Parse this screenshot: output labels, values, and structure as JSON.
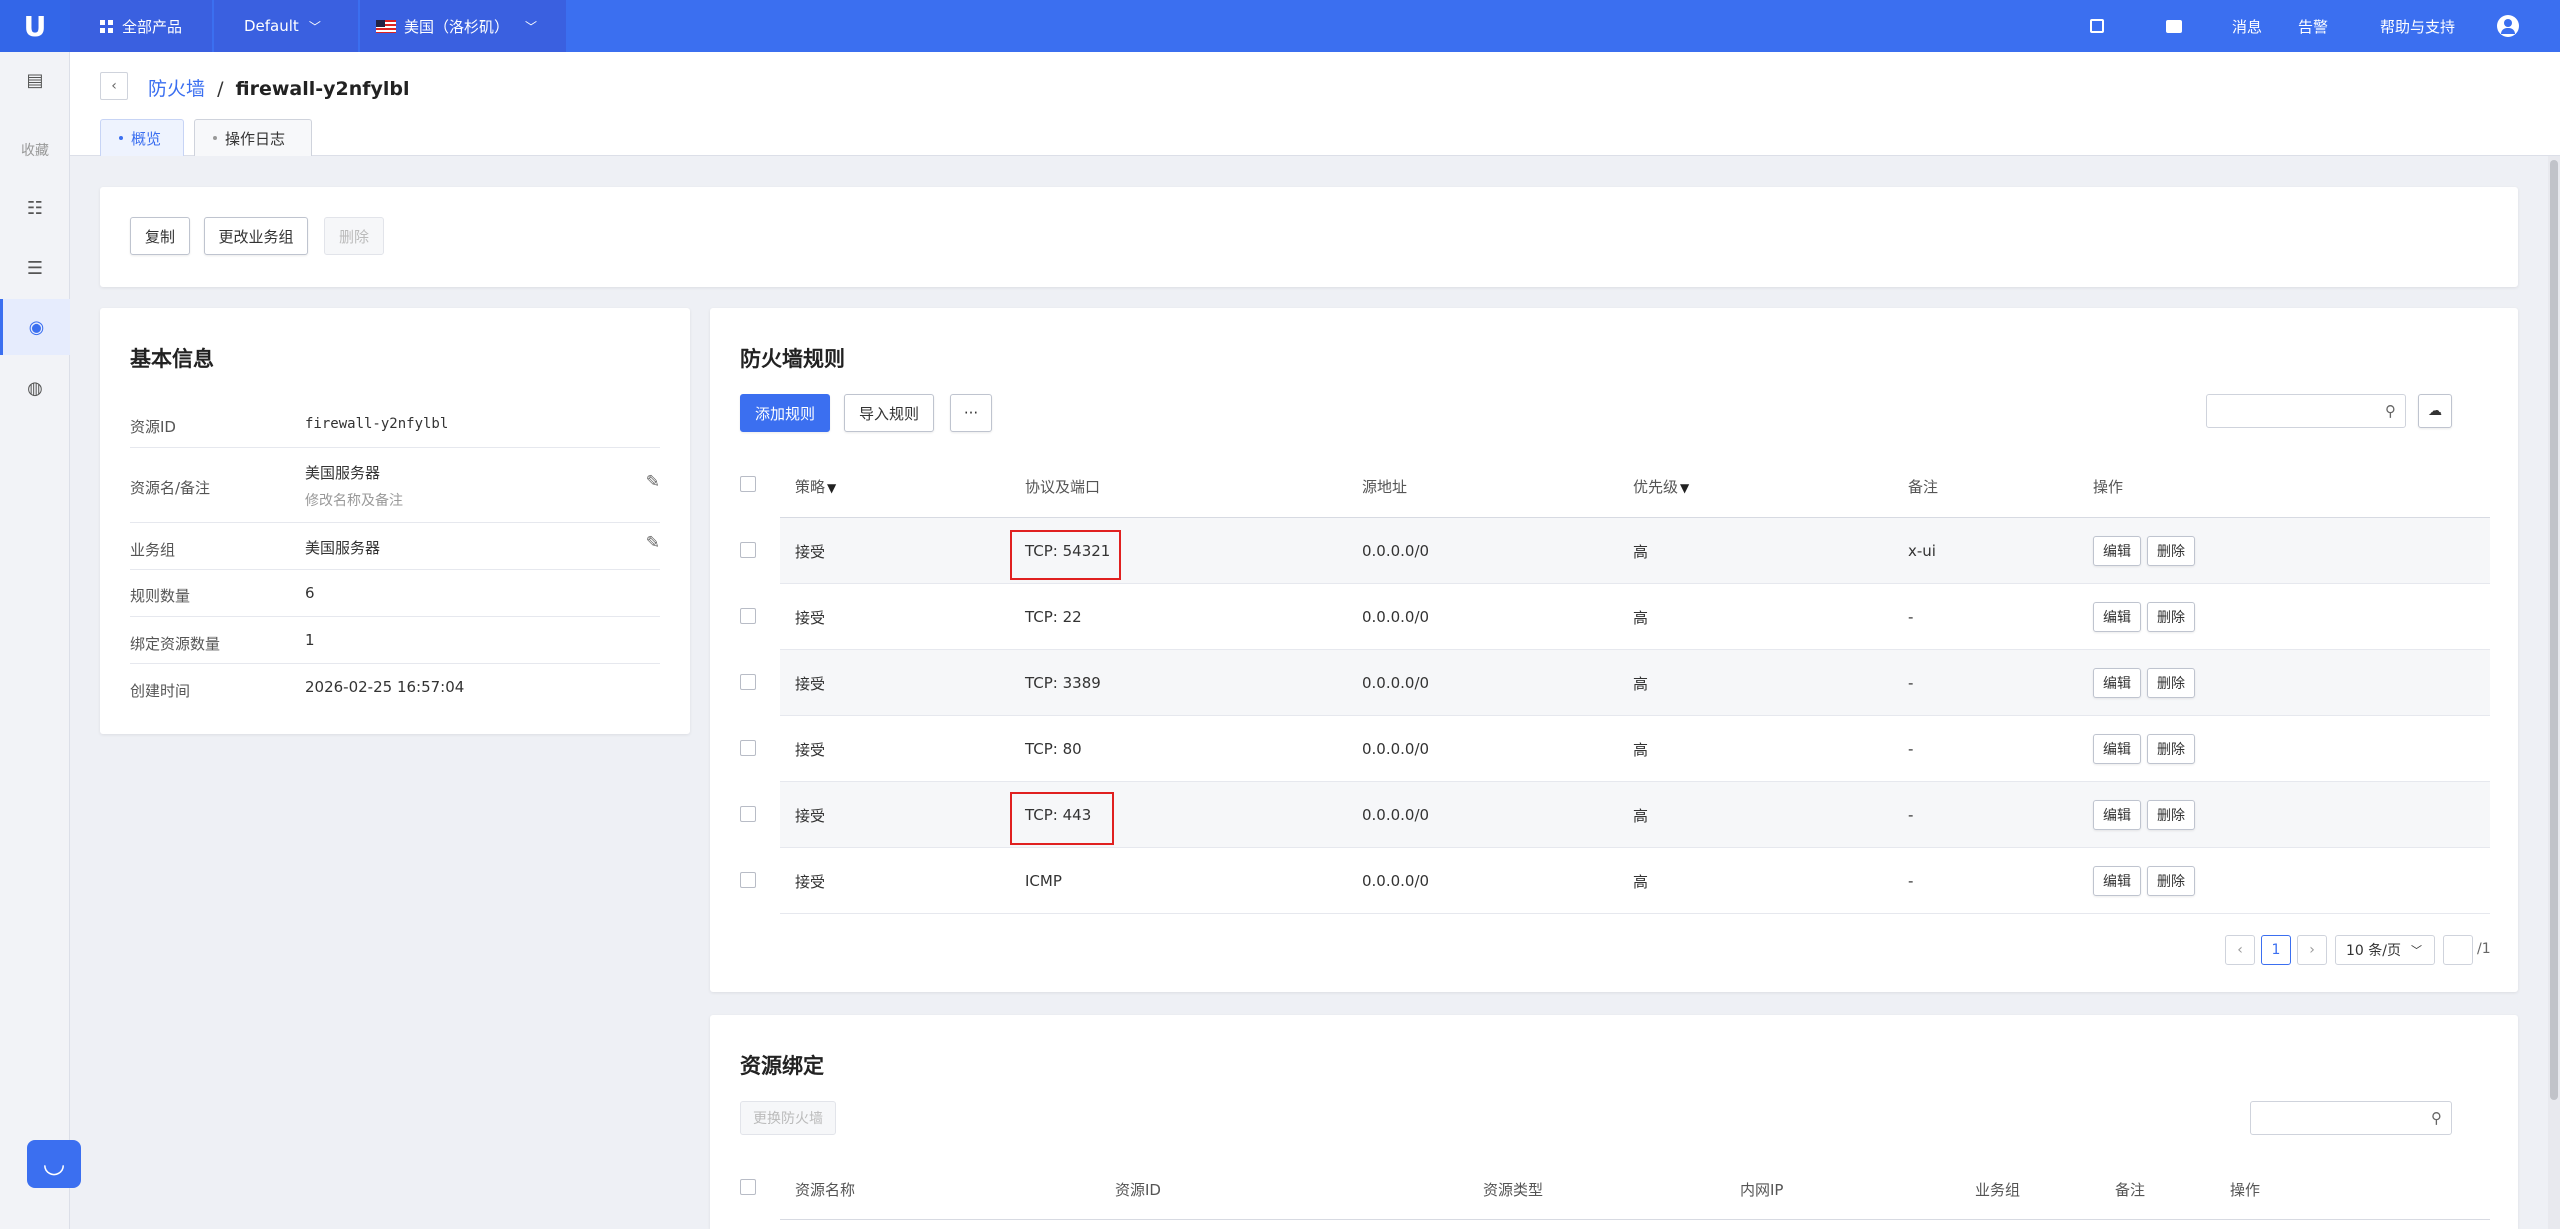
{
  "topbar": {
    "logo": "U",
    "all_products": "全部产品",
    "project": "Default",
    "region": "美国（洛杉矶）",
    "messages": "消息",
    "alerts": "告警",
    "help": "帮助与支持"
  },
  "sidebar": {
    "favorites": "收藏"
  },
  "header": {
    "breadcrumb_parent": "防火墙",
    "breadcrumb_sep": "/",
    "breadcrumb_current": "firewall-y2nfylbl",
    "tabs": [
      {
        "label": "概览"
      },
      {
        "label": "操作日志"
      }
    ]
  },
  "actions": {
    "copy": "复制",
    "change_group": "更改业务组",
    "delete": "删除"
  },
  "basic_info": {
    "title": "基本信息",
    "rows": [
      {
        "label": "资源ID",
        "value": "firewall-y2nfylbl"
      },
      {
        "label": "资源名/备注",
        "value": "美国服务器",
        "sub": "修改名称及备注"
      },
      {
        "label": "业务组",
        "value": "美国服务器"
      },
      {
        "label": "规则数量",
        "value": "6"
      },
      {
        "label": "绑定资源数量",
        "value": "1"
      },
      {
        "label": "创建时间",
        "value": "2026-02-25 16:57:04"
      }
    ]
  },
  "rules": {
    "title": "防火墙规则",
    "add_button": "添加规则",
    "import_button": "导入规则",
    "more_button": "···",
    "headers": {
      "policy": "策略",
      "protocol_port": "协议及端口",
      "source": "源地址",
      "priority": "优先级",
      "remark": "备注",
      "actions": "操作"
    },
    "edit_label": "编辑",
    "delete_label": "删除",
    "rows": [
      {
        "policy": "接受",
        "protocol": "TCP: 54321",
        "source": "0.0.0.0/0",
        "priority": "高",
        "remark": "x-ui"
      },
      {
        "policy": "接受",
        "protocol": "TCP: 22",
        "source": "0.0.0.0/0",
        "priority": "高",
        "remark": "-"
      },
      {
        "policy": "接受",
        "protocol": "TCP: 3389",
        "source": "0.0.0.0/0",
        "priority": "高",
        "remark": "-"
      },
      {
        "policy": "接受",
        "protocol": "TCP: 80",
        "source": "0.0.0.0/0",
        "priority": "高",
        "remark": "-"
      },
      {
        "policy": "接受",
        "protocol": "TCP: 443",
        "source": "0.0.0.0/0",
        "priority": "高",
        "remark": "-"
      },
      {
        "policy": "接受",
        "protocol": "ICMP",
        "source": "0.0.0.0/0",
        "priority": "高",
        "remark": "-"
      }
    ],
    "pagination": {
      "current_page": "1",
      "page_size": "10 条/页",
      "total_pages": "/1"
    }
  },
  "binding": {
    "title": "资源绑定",
    "change_button": "更换防火墙",
    "headers": {
      "name": "资源名称",
      "id": "资源ID",
      "type": "资源类型",
      "ip": "内网IP",
      "group": "业务组",
      "remark": "备注",
      "actions": "操作"
    }
  }
}
